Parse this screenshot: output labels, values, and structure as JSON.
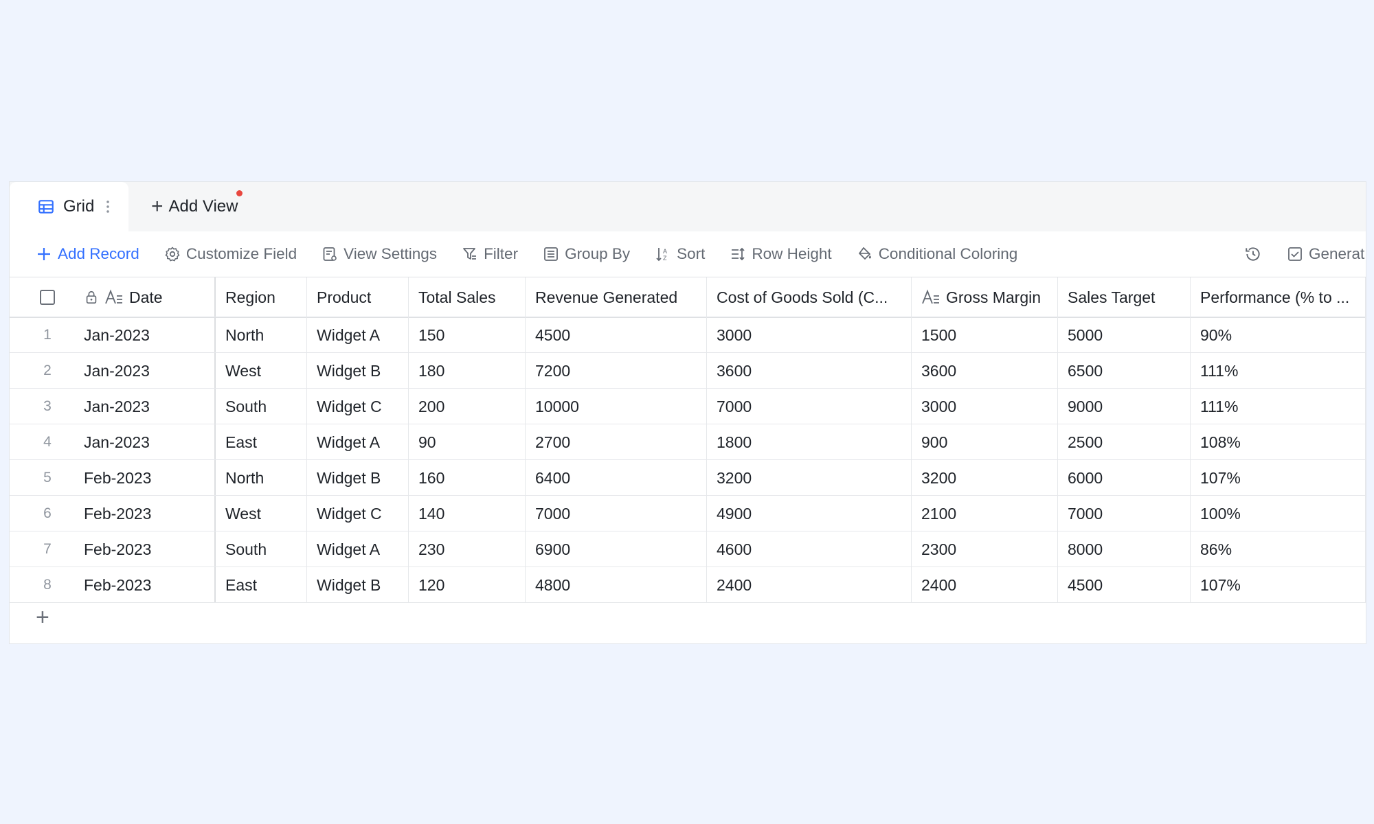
{
  "tabs": {
    "active_label": "Grid",
    "add_view_label": "Add View"
  },
  "toolbar": {
    "add_record": "Add Record",
    "customize_field": "Customize Field",
    "view_settings": "View Settings",
    "filter": "Filter",
    "group_by": "Group By",
    "sort": "Sort",
    "row_height": "Row Height",
    "conditional_coloring": "Conditional Coloring",
    "generate": "Generat"
  },
  "colors": {
    "accent": "#3370ff",
    "badge": "#e8473f",
    "background": "#eff4fe"
  },
  "table": {
    "columns": [
      "Date",
      "Region",
      "Product",
      "Total Sales",
      "Revenue Generated",
      "Cost of Goods Sold (C...",
      "Gross Margin",
      "Sales Target",
      "Performance (% to ..."
    ],
    "rows": [
      {
        "num": "1",
        "cells": [
          "Jan-2023",
          "North",
          "Widget A",
          "150",
          "4500",
          "3000",
          "1500",
          "5000",
          "90%"
        ]
      },
      {
        "num": "2",
        "cells": [
          "Jan-2023",
          "West",
          "Widget B",
          "180",
          "7200",
          "3600",
          "3600",
          "6500",
          "111%"
        ]
      },
      {
        "num": "3",
        "cells": [
          "Jan-2023",
          "South",
          "Widget C",
          "200",
          "10000",
          "7000",
          "3000",
          "9000",
          "111%"
        ]
      },
      {
        "num": "4",
        "cells": [
          "Jan-2023",
          "East",
          "Widget A",
          "90",
          "2700",
          "1800",
          "900",
          "2500",
          "108%"
        ]
      },
      {
        "num": "5",
        "cells": [
          "Feb-2023",
          "North",
          "Widget B",
          "160",
          "6400",
          "3200",
          "3200",
          "6000",
          "107%"
        ]
      },
      {
        "num": "6",
        "cells": [
          "Feb-2023",
          "West",
          "Widget C",
          "140",
          "7000",
          "4900",
          "2100",
          "7000",
          "100%"
        ]
      },
      {
        "num": "7",
        "cells": [
          "Feb-2023",
          "South",
          "Widget A",
          "230",
          "6900",
          "4600",
          "2300",
          "8000",
          "86%"
        ]
      },
      {
        "num": "8",
        "cells": [
          "Feb-2023",
          "East",
          "Widget B",
          "120",
          "4800",
          "2400",
          "2400",
          "4500",
          "107%"
        ]
      }
    ]
  }
}
